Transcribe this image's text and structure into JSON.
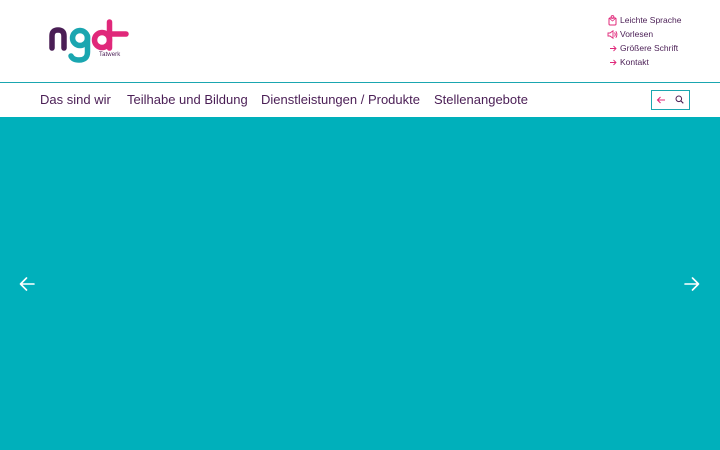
{
  "logo": {
    "subtitle": "Tatwerk"
  },
  "service": {
    "items": [
      {
        "label": "Leichte Sprache",
        "icon": "easy-language-icon"
      },
      {
        "label": "Vorlesen",
        "icon": "speaker-icon"
      },
      {
        "label": "Größere Schrift",
        "icon": "arrow-right-icon"
      },
      {
        "label": "Kontakt",
        "icon": "arrow-right-icon"
      }
    ]
  },
  "nav": {
    "items": [
      {
        "label": "Das sind wir"
      },
      {
        "label": "Teilhabe und Bildung"
      },
      {
        "label": "Dienstleistungen / Produkte"
      },
      {
        "label": "Stellenangebote"
      }
    ],
    "tools": [
      {
        "icon": "arrow-left-icon"
      },
      {
        "icon": "search-icon"
      }
    ]
  },
  "hero": {
    "background": "#00b0bb",
    "prev_icon": "arrow-left-icon",
    "next_icon": "arrow-right-icon"
  },
  "colors": {
    "brand_purple": "#4a1e55",
    "brand_pink": "#e0287a",
    "brand_teal": "#1aa6b0"
  }
}
